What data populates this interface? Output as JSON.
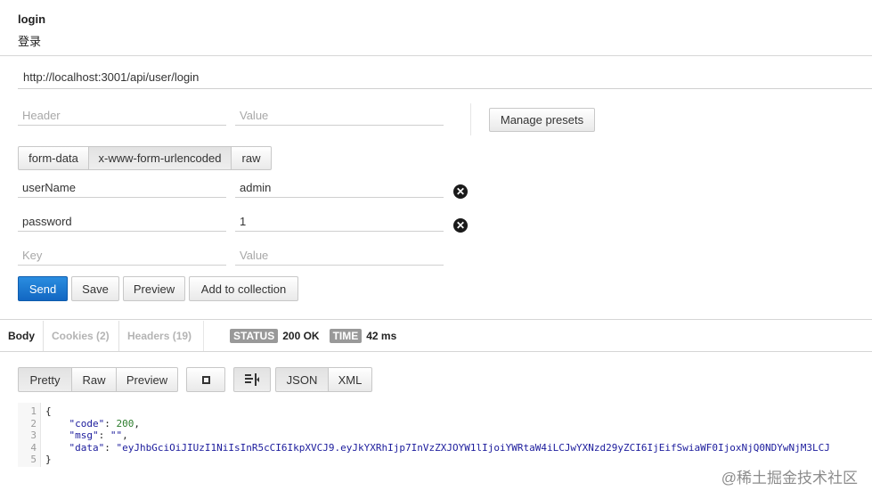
{
  "request": {
    "name": "login",
    "description": "登录",
    "url": "http://localhost:3001/api/user/login"
  },
  "headers": {
    "header_placeholder": "Header",
    "value_placeholder": "Value",
    "manage_presets_label": "Manage presets"
  },
  "body_modes": [
    "form-data",
    "x-www-form-urlencoded",
    "raw"
  ],
  "selected_body_mode": "x-www-form-urlencoded",
  "params": [
    {
      "key": "userName",
      "value": "admin"
    },
    {
      "key": "password",
      "value": "1"
    }
  ],
  "param_placeholders": {
    "key": "Key",
    "value": "Value"
  },
  "actions": {
    "send": "Send",
    "save": "Save",
    "preview": "Preview",
    "add_to_collection": "Add to collection"
  },
  "response_tabs": {
    "body": "Body",
    "cookies": "Cookies (2)",
    "headers": "Headers (19)"
  },
  "status": {
    "label": "STATUS",
    "value": "200 OK"
  },
  "time": {
    "label": "TIME",
    "value": "42 ms"
  },
  "view_modes": [
    "Pretty",
    "Raw",
    "Preview"
  ],
  "formats": [
    "JSON",
    "XML"
  ],
  "response_body": {
    "line_numbers": [
      "1",
      "2",
      "3",
      "4",
      "5"
    ],
    "line1": "{",
    "code_key": "\"code\"",
    "code_value": "200",
    "msg_key": "\"msg\"",
    "msg_value": "\"\"",
    "data_key": "\"data\"",
    "data_value": "\"eyJhbGciOiJIUzI1NiIsInR5cCI6IkpXVCJ9.eyJkYXRhIjp7InVzZXJOYW1lIjoiYWRtaW4iLCJwYXNzd29yZCI6IjEifSwiaWF0IjoxNjQ0NDYwNjM3LCJ",
    "line5": "}"
  },
  "watermark": "@稀土掘金技术社区",
  "colors": {
    "primary": "#1a73c9",
    "badge": "#999999",
    "json_key": "#1b1b9c",
    "json_number": "#2d7d2d"
  }
}
